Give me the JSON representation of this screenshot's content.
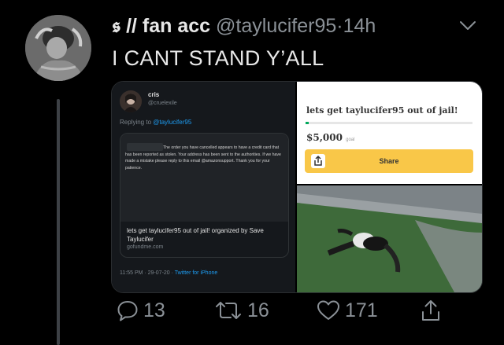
{
  "tweet": {
    "display_name": "𝖘 // fan acc",
    "handle": "@taylucifer95",
    "separator": "·",
    "time": "14h",
    "text": "I CANT STAND Y’ALL"
  },
  "embedded_tweet": {
    "name": "cris",
    "handle": "@cruelexile",
    "replying_prefix": "Replying to ",
    "replying_handle": "@taylucifer95",
    "quoted_email_text": "The order you have cancelled appears to have a credit card that has been reported as stolen. Your address has been sent to the authorities. If we have made a mistake please reply to this email @amazonsupport. Thank you for your patience.",
    "link_title": "lets get taylucifer95 out of jail! organized by Save Taylucifer",
    "link_domain": "gofundme.com",
    "timestamp": "11:55 PM · 29-07-20 · ",
    "app": "Twitter for iPhone"
  },
  "gofundme": {
    "title": "lets get taylucifer95 out of jail!",
    "amount": "$5,000",
    "goal_label": "goal",
    "share_label": "Share"
  },
  "actions": {
    "replies": "13",
    "retweets": "16",
    "likes": "171"
  },
  "icons": [
    "chevron-down-icon",
    "reply-icon",
    "retweet-icon",
    "like-icon",
    "share-icon"
  ],
  "colors": {
    "background": "#000000",
    "muted": "#8b9197",
    "link": "#1d9bf0",
    "gofundme_green": "#02a95c",
    "share_yellow": "#f9c748"
  }
}
